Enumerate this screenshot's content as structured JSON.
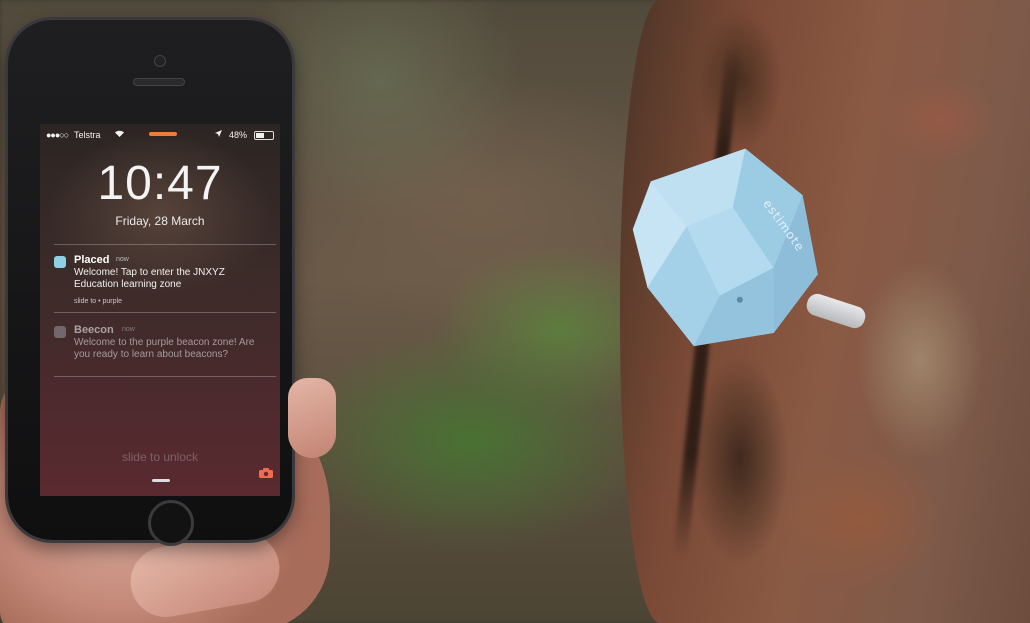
{
  "phone": {
    "status": {
      "signal": "●●●○○",
      "carrier": "Telstra",
      "wifi_icon": "wifi-icon",
      "location_icon": "location-arrow-icon",
      "battery_percent": "48%",
      "battery_level": 0.48
    },
    "lock_screen": {
      "time": "10:47",
      "date": "Friday, 28 March",
      "slide_to_unlock": "slide to unlock"
    },
    "notifications": [
      {
        "app": "Placed",
        "when": "now",
        "body": "Welcome! Tap to enter the JNXYZ Education learning zone",
        "action": "slide to  • purple",
        "icon_color": "#8fd0e6"
      },
      {
        "app": "Beecon",
        "when": "now",
        "body": "Welcome to the purple beacon zone! Are you ready to learn about beacons?",
        "action": "",
        "icon_color": "#9a9aa0"
      }
    ]
  },
  "beacon": {
    "brand": "estimote",
    "color": "#a9d3ea"
  },
  "colors": {
    "notification_accent": "#f07c3a",
    "camera_icon": "#f16b4e"
  }
}
